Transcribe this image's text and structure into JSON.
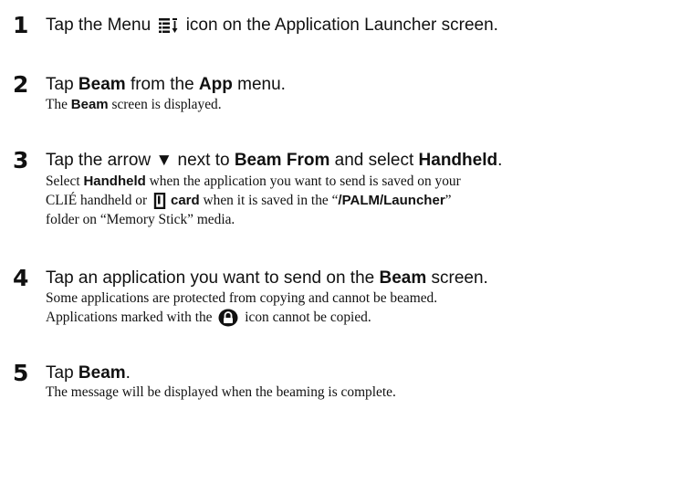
{
  "steps": [
    {
      "number": "1",
      "head": {
        "pre": "Tap the Menu",
        "post": "icon on the Application Launcher screen."
      },
      "icon": "menu-icon"
    },
    {
      "number": "2",
      "head": {
        "t1": "Tap ",
        "b1": "Beam",
        "t2": " from the ",
        "b2": "App",
        "t3": " menu."
      },
      "body": [
        {
          "t1": "The ",
          "b1": "Beam",
          "t2": " screen is displayed."
        }
      ]
    },
    {
      "number": "3",
      "head": {
        "t1": "Tap the arrow ",
        "arrow": "▼",
        "t2": " next to ",
        "b1": "Beam From",
        "t3": " and select ",
        "b2": "Handheld",
        "t4": "."
      },
      "body": [
        {
          "t1": "Select ",
          "b1": "Handheld",
          "t2": " when the application you want to send is saved on your"
        },
        {
          "t1": "CLIÉ handheld or ",
          "b1": "card",
          "t2": " when it is saved in the “",
          "b2": "/PALM/Launcher",
          "t3": "”"
        },
        {
          "t1": "folder on “Memory Stick” media."
        }
      ],
      "icon": "memory-stick-icon"
    },
    {
      "number": "4",
      "head": {
        "t1": "Tap an application you want to send on the ",
        "b1": "Beam",
        "t2": " screen."
      },
      "body": [
        {
          "t1": "Some applications are protected from copying and cannot be beamed."
        },
        {
          "t1": "Applications marked with the",
          "t2": "icon cannot be copied."
        }
      ],
      "icon": "lock-icon"
    },
    {
      "number": "5",
      "head": {
        "t1": "Tap ",
        "b1": "Beam",
        "t2": "."
      },
      "body": [
        {
          "t1": "The message will be displayed when the beaming is complete."
        }
      ]
    }
  ]
}
